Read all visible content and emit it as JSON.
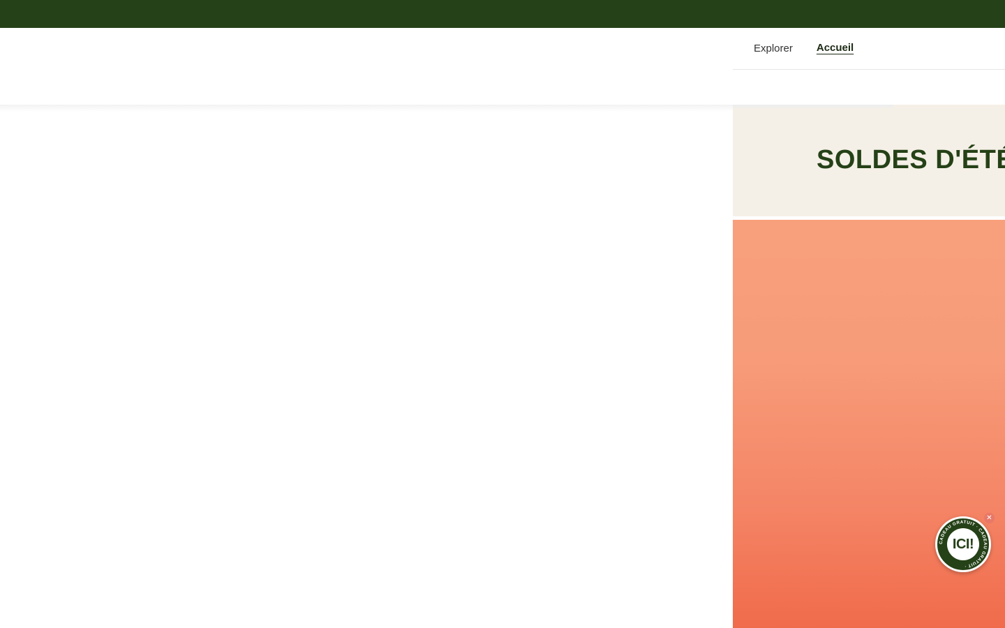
{
  "colors": {
    "top_bar": "#254117",
    "promo_background": "#f5f0e7",
    "promo_text": "#254117",
    "hero_gradient_top": "#f8a07c",
    "hero_gradient_bottom": "#f06b4b"
  },
  "nav": {
    "items": [
      {
        "label": "Explorer",
        "active": false
      },
      {
        "label": "Accueil",
        "active": true
      }
    ]
  },
  "promo": {
    "title": "SOLDES D'ÉTÉ"
  },
  "gift_widget": {
    "center_text": "ICI!",
    "ring_text": "CADEAU GRATUIT · CADEAU GRATUIT ·",
    "close_icon": "close-icon"
  }
}
